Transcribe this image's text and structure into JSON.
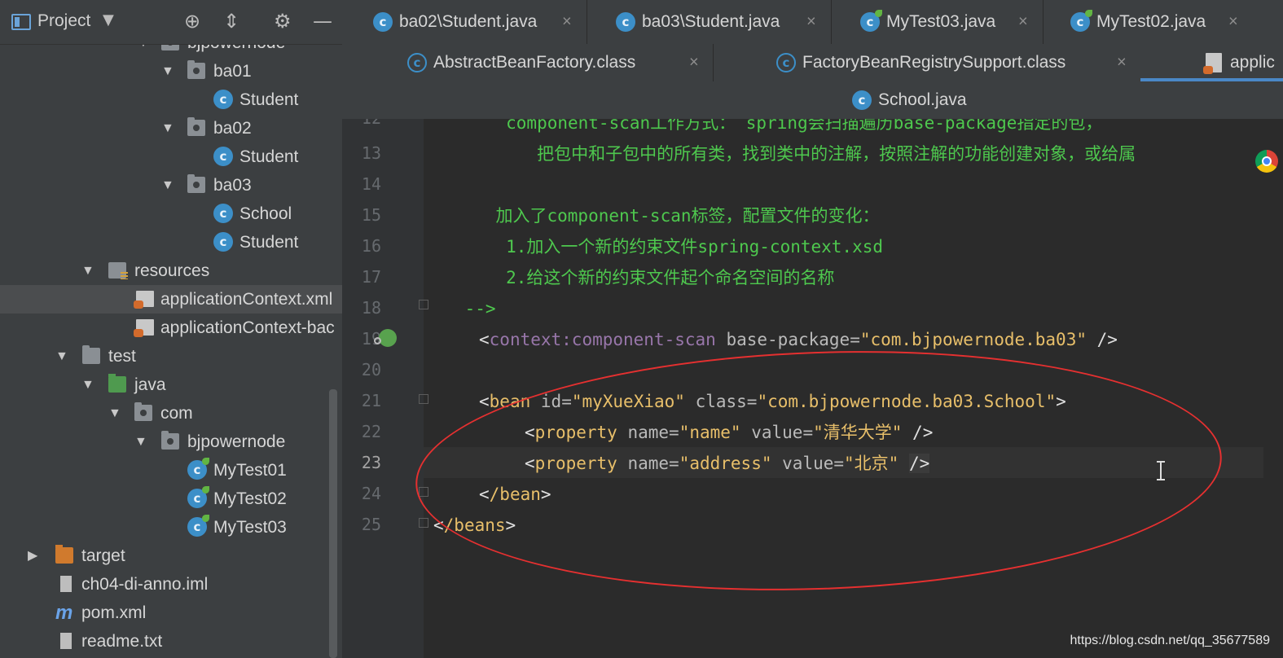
{
  "sidebar": {
    "title": "Project",
    "tree": [
      {
        "label": "bjpowernode",
        "icon": "package-folder-icon",
        "expanded": true
      },
      {
        "label": "ba01",
        "icon": "package-folder-icon",
        "expanded": true
      },
      {
        "label": "Student",
        "icon": "java-class-icon"
      },
      {
        "label": "ba02",
        "icon": "package-folder-icon",
        "expanded": true
      },
      {
        "label": "Student",
        "icon": "java-class-icon"
      },
      {
        "label": "ba03",
        "icon": "package-folder-icon",
        "expanded": true
      },
      {
        "label": "School",
        "icon": "java-class-icon"
      },
      {
        "label": "Student",
        "icon": "java-class-icon"
      },
      {
        "label": "resources",
        "icon": "resources-folder-icon",
        "expanded": true
      },
      {
        "label": "applicationContext.xml",
        "icon": "spring-xml-icon",
        "selected": true
      },
      {
        "label": "applicationContext-bac",
        "icon": "spring-xml-icon"
      },
      {
        "label": "test",
        "icon": "folder-icon",
        "expanded": true
      },
      {
        "label": "java",
        "icon": "test-source-folder-icon",
        "expanded": true
      },
      {
        "label": "com",
        "icon": "package-folder-icon",
        "expanded": true
      },
      {
        "label": "bjpowernode",
        "icon": "package-folder-icon",
        "expanded": true
      },
      {
        "label": "MyTest01",
        "icon": "test-class-icon"
      },
      {
        "label": "MyTest02",
        "icon": "test-class-icon"
      },
      {
        "label": "MyTest03",
        "icon": "test-class-icon"
      },
      {
        "label": "target",
        "icon": "excluded-folder-icon",
        "expanded": false
      },
      {
        "label": "ch04-di-anno.iml",
        "icon": "iml-file-icon"
      },
      {
        "label": "pom.xml",
        "icon": "maven-icon"
      },
      {
        "label": "readme.txt",
        "icon": "text-file-icon"
      }
    ]
  },
  "tabs": {
    "row1": [
      {
        "label": "ba02\\Student.java",
        "icon": "java-class-icon"
      },
      {
        "label": "ba03\\Student.java",
        "icon": "java-class-icon"
      },
      {
        "label": "MyTest03.java",
        "icon": "test-class-icon"
      },
      {
        "label": "MyTest02.java",
        "icon": "test-class-icon"
      }
    ],
    "row2": [
      {
        "label": "AbstractBeanFactory.class",
        "icon": "compiled-class-icon"
      },
      {
        "label": "FactoryBeanRegistrySupport.class",
        "icon": "compiled-class-icon"
      },
      {
        "label": "applic",
        "icon": "spring-xml-icon",
        "active": true
      }
    ],
    "row3": [
      {
        "label": "School.java",
        "icon": "java-class-icon"
      }
    ],
    "close_glyph": "×"
  },
  "editor": {
    "current_line": 23,
    "lines": [
      {
        "n": "12",
        "text": "        component-scan工作方式： spring会扫描遍历base-package指定的包，"
      },
      {
        "n": "13",
        "text": "           把包中和子包中的所有类，找到类中的注解，按照注解的功能创建对象，或给属"
      },
      {
        "n": "14",
        "text": ""
      },
      {
        "n": "15",
        "text": "       加入了component-scan标签，配置文件的变化："
      },
      {
        "n": "16",
        "text": "        1.加入一个新的约束文件spring-context.xsd"
      },
      {
        "n": "17",
        "text": "        2.给这个新的约束文件起个命名空间的名称"
      },
      {
        "n": "18",
        "text": "    -->"
      },
      {
        "n": "19",
        "tag": "context:component-scan",
        "attr": "base-package",
        "val": "\"com.bjpowernode.ba03\""
      },
      {
        "n": "20",
        "text": ""
      },
      {
        "n": "21",
        "tag": "bean",
        "a1": "id",
        "v1": "\"myXueXiao\"",
        "a2": "class",
        "v2": "\"com.bjpowernode.ba03.School\""
      },
      {
        "n": "22",
        "tag": "property",
        "a1": "name",
        "v1": "\"name\"",
        "a2": "value",
        "v2": "\"清华大学\""
      },
      {
        "n": "23",
        "tag": "property",
        "a1": "name",
        "v1": "\"address\"",
        "a2": "value",
        "v2": "\"北京\""
      },
      {
        "n": "24",
        "tag": "/bean"
      },
      {
        "n": "25",
        "tag": "/beans"
      }
    ]
  },
  "watermark": "https://blog.csdn.net/qq_35677589",
  "colors": {
    "comment": "#4ec84e",
    "tag": "#e8bf6a",
    "attr_value": "#a5c25c",
    "annotation_ellipse": "#e53030"
  }
}
